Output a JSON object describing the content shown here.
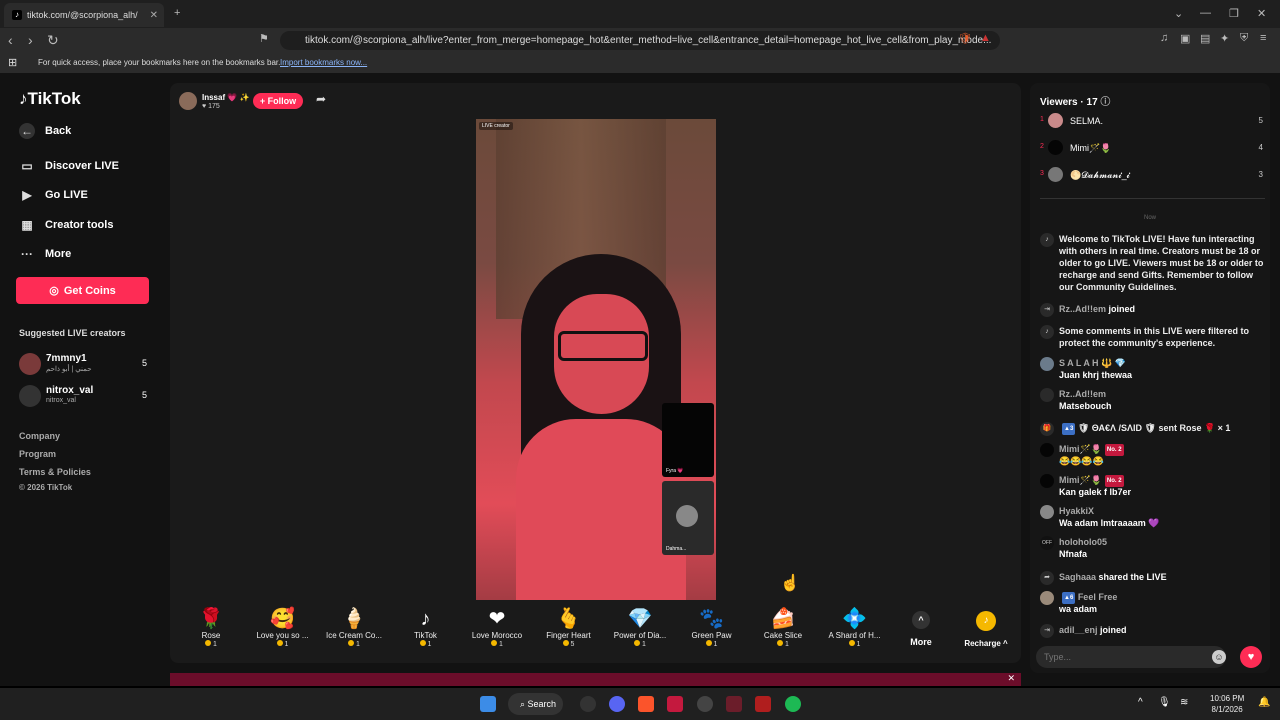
{
  "browser": {
    "tab_title": "tiktok.com/@scorpiona_alh/",
    "url": "tiktok.com/@scorpiona_alh/live?enter_from_merge=homepage_hot&enter_method=live_cell&entrance_detail=homepage_hot_live_cell&from_play_mode...",
    "bookmarks_text": "For quick access, place your bookmarks here on the bookmarks bar.",
    "import_link": "Import bookmarks now..."
  },
  "nav": {
    "logo": "TikTok",
    "back": "Back",
    "discover": "Discover LIVE",
    "golive": "Go LIVE",
    "creator_tools": "Creator tools",
    "more": "More",
    "get_coins": "Get Coins",
    "suggested_label": "Suggested LIVE creators",
    "creators": [
      {
        "name": "7mmny1",
        "sub": "حمني | أبو ذاحم",
        "count": "5"
      },
      {
        "name": "nitrox_val",
        "sub": "nitrox_val",
        "count": "5"
      }
    ],
    "footer": [
      "Company",
      "Program",
      "Terms & Policies",
      "© 2026 TikTok"
    ]
  },
  "stream": {
    "host_name": "Inssaf 💗 ✨",
    "host_count": "175",
    "follow": "+ Follow",
    "live_badge": "LIVE creator",
    "guest1_label": "Fyra 💗",
    "guest2_label": "Dahma..."
  },
  "gifts": [
    {
      "icon": "🌹",
      "name": "Rose",
      "price": "1"
    },
    {
      "icon": "🥰",
      "name": "Love you so ...",
      "price": "1"
    },
    {
      "icon": "🍦",
      "name": "Ice Cream Co...",
      "price": "1"
    },
    {
      "icon": "♪",
      "name": "TikTok",
      "price": "1"
    },
    {
      "icon": "❤",
      "name": "Love Morocco",
      "price": "1"
    },
    {
      "icon": "🫰",
      "name": "Finger Heart",
      "price": "5"
    },
    {
      "icon": "💎",
      "name": "Power of Dia...",
      "price": "1"
    },
    {
      "icon": "🐾",
      "name": "Green Paw",
      "price": "1"
    },
    {
      "icon": "🍰",
      "name": "Cake Slice",
      "price": "1"
    },
    {
      "icon": "💠",
      "name": "A Shard of H...",
      "price": "1"
    }
  ],
  "gift_more": "More",
  "recharge": "Recharge",
  "chat": {
    "viewers_label": "Viewers · 17",
    "viewers": [
      {
        "rank": "1",
        "name": "SELMA.",
        "count": "5"
      },
      {
        "rank": "2",
        "name": "Mimi🪄🌷",
        "count": "4"
      },
      {
        "rank": "3",
        "name": "🌕𝓓𝓪𝓱𝓶𝓪𝓷𝓲_𝓲",
        "count": "3"
      }
    ],
    "now_label": "Now",
    "welcome": "Welcome to TikTok LIVE! Have fun interacting with others in real time. Creators must be 18 or older to go LIVE. Viewers must be 18 or older to recharge and send Gifts. Remember to follow our Community Guidelines.",
    "joined1_user": "Rz..Ad!!em",
    "joined_word": "joined",
    "filtered": "Some comments in this LIVE were filtered to protect the community's experience.",
    "messages": [
      {
        "user": "S A L A H 🔱 💎",
        "text": "Juan khrj thewaa"
      },
      {
        "user": "Rz..Ad!!em",
        "text": "Matsebouch"
      }
    ],
    "rose_sender": "🛡 ΘΑ€Λ /SΛID 🛡 sent Rose 🌹 × 1",
    "rose_level": "3",
    "mimi1_user": "Mimi🪄🌷",
    "mimi1_tag": "No. 2",
    "mimi1_text": "😂😂😂😂",
    "mimi2_user": "Mimi🪄🌷",
    "mimi2_tag": "No. 2",
    "mimi2_text": "Kan galek f lb7er",
    "hyakki_user": "HyakkiX",
    "hyakki_text": "Wa adam lmtraaaam 💜",
    "holo_user": "holoholo05",
    "holo_text": "Nfnafa",
    "shared_user": "Saghaaa",
    "shared_text": "shared the LIVE",
    "feel_user": "Feel Free",
    "feel_level": "6",
    "feel_text": "wa adam",
    "joined2_user": "adil__enj",
    "input_placeholder": "Type..."
  },
  "taskbar": {
    "search": "Search",
    "time": "10:06 PM",
    "date": "8/1/2026"
  }
}
